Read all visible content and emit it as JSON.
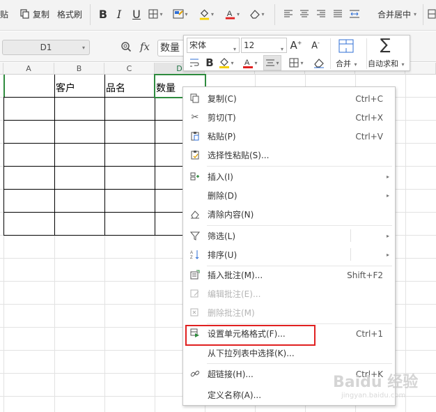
{
  "ribbon": {
    "paste_label": "贴",
    "copy_label": "复制",
    "format_painter_label": "格式刷",
    "merge_center_label": "合并居中",
    "merge_dropdown": "▾"
  },
  "formula_bar": {
    "cell_ref": "D1",
    "fx_label": "fx",
    "value": "数量"
  },
  "mini_toolbar": {
    "font_name": "宋体",
    "font_size": "12",
    "merge_label": "合并",
    "autosum_label": "自动求和"
  },
  "columns": [
    "A",
    "B",
    "C",
    "D"
  ],
  "cells": {
    "b1": "客户",
    "c1": "品名",
    "d1": "数量"
  },
  "context_menu": {
    "items": [
      {
        "label": "复制(C)",
        "shortcut": "Ctrl+C",
        "icon": "copy-icon"
      },
      {
        "label": "剪切(T)",
        "shortcut": "Ctrl+X",
        "icon": "scissors-icon"
      },
      {
        "label": "粘贴(P)",
        "shortcut": "Ctrl+V",
        "icon": "paste-icon"
      },
      {
        "label": "选择性粘贴(S)...",
        "shortcut": "",
        "icon": "paste-special-icon"
      },
      {
        "label": "插入(I)",
        "shortcut": "",
        "icon": "insert-icon"
      },
      {
        "label": "删除(D)",
        "shortcut": "",
        "icon": ""
      },
      {
        "label": "清除内容(N)",
        "shortcut": "",
        "icon": "eraser-icon"
      },
      {
        "label": "筛选(L)",
        "shortcut": "",
        "icon": "filter-icon"
      },
      {
        "label": "排序(U)",
        "shortcut": "",
        "icon": "sort-icon"
      },
      {
        "label": "插入批注(M)...",
        "shortcut": "Shift+F2",
        "icon": "comment-icon"
      },
      {
        "label": "编辑批注(E)...",
        "shortcut": "",
        "icon": "edit-comment-icon"
      },
      {
        "label": "删除批注(M)",
        "shortcut": "",
        "icon": "delete-comment-icon"
      },
      {
        "label": "设置单元格格式(F)...",
        "shortcut": "Ctrl+1",
        "icon": "format-cells-icon"
      },
      {
        "label": "从下拉列表中选择(K)...",
        "shortcut": "",
        "icon": ""
      },
      {
        "label": "超链接(H)...",
        "shortcut": "Ctrl+K",
        "icon": "link-icon"
      },
      {
        "label": "定义名称(A)...",
        "shortcut": "",
        "icon": ""
      }
    ]
  },
  "watermark": {
    "brand": "Baidu 经验",
    "url": "jingyan.baidu.com"
  },
  "colors": {
    "selection": "#2e8b3e",
    "highlight": "#e02020",
    "font_color_red": "#e02020",
    "fill_yellow": "#f5d000",
    "accent_blue": "#2f6fd6"
  }
}
